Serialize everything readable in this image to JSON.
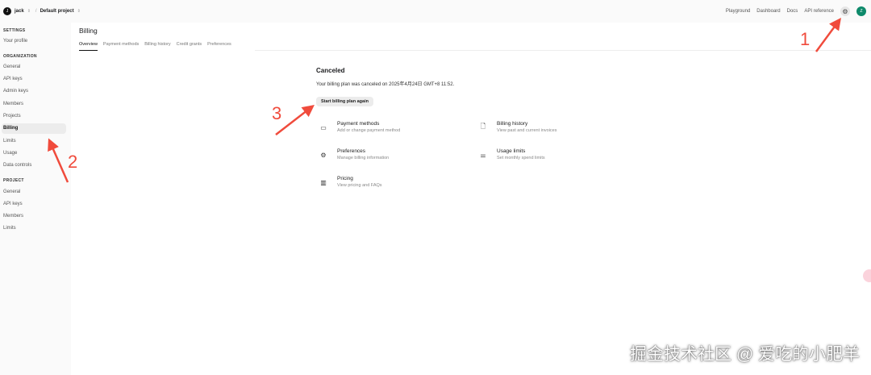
{
  "topbar": {
    "avatar": "J",
    "user": "jack",
    "project": "Default project",
    "links": [
      "Playground",
      "Dashboard",
      "Docs",
      "API reference"
    ],
    "user_avatar": "Z"
  },
  "sidebar": {
    "settings": "SETTINGS",
    "your_profile": "Your profile",
    "organization": "ORGANIZATION",
    "org_items": [
      "General",
      "API keys",
      "Admin keys",
      "Members",
      "Projects",
      "Billing",
      "Limits",
      "Usage",
      "Data controls"
    ],
    "project": "PROJECT",
    "project_items": [
      "General",
      "API keys",
      "Members",
      "Limits"
    ]
  },
  "main": {
    "title": "Billing",
    "tabs": [
      "Overview",
      "Payment methods",
      "Billing history",
      "Credit grants",
      "Preferences"
    ],
    "status": "Canceled",
    "message": "Your billing plan was canceled on 2025年4月24日 GMT+8 11:52.",
    "restart": "Start billing plan again",
    "cards": [
      {
        "title": "Payment methods",
        "sub": "Add or change payment method",
        "icon": "credit-card-icon"
      },
      {
        "title": "Billing history",
        "sub": "View past and current invoices",
        "icon": "document-icon"
      },
      {
        "title": "Preferences",
        "sub": "Manage billing information",
        "icon": "gear-icon"
      },
      {
        "title": "Usage limits",
        "sub": "Set monthly spend limits",
        "icon": "sliders-icon"
      },
      {
        "title": "Pricing",
        "sub": "View pricing and FAQs",
        "icon": "chart-icon"
      }
    ]
  },
  "annotations": [
    "1",
    "2",
    "3"
  ],
  "watermark": "掘金技术社区 @ 爱吃的小肥羊",
  "colors": {
    "arrow": "#f04b3c",
    "accent": "#0e8a6b"
  }
}
